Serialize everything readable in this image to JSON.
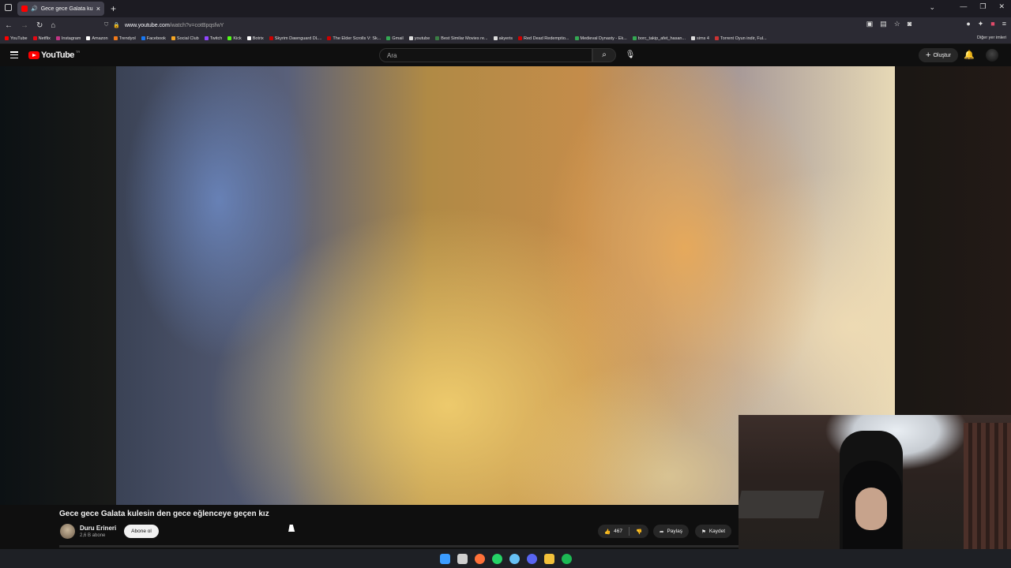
{
  "browser": {
    "tab_title": "Gece gece Galata kulesin d...",
    "url_host": "www.youtube.com",
    "url_path": "/watch?v=cotBpqsfwY",
    "bookmarks": [
      {
        "label": "YouTube",
        "color": "#ff0000"
      },
      {
        "label": "Netflix",
        "color": "#e50914"
      },
      {
        "label": "Instagram",
        "color": "#c13584"
      },
      {
        "label": "Amazon",
        "color": "#ffffff"
      },
      {
        "label": "Trendyol",
        "color": "#f27a1a"
      },
      {
        "label": "Facebook",
        "color": "#1877f2"
      },
      {
        "label": "Social Club",
        "color": "#f5a623"
      },
      {
        "label": "Twitch",
        "color": "#9146ff"
      },
      {
        "label": "Kick",
        "color": "#53fc18"
      },
      {
        "label": "Botrix",
        "color": "#ffffff"
      },
      {
        "label": "Skyrim Dawnguard DL...",
        "color": "#cc0000"
      },
      {
        "label": "The Elder Scrolls V: Sk...",
        "color": "#cc0000"
      },
      {
        "label": "Gmail",
        "color": "#34a853"
      },
      {
        "label": "youtube",
        "color": "#dddddd"
      },
      {
        "label": "Best Similar Movies re...",
        "color": "#3a7d44"
      },
      {
        "label": "akyeris",
        "color": "#dddddd"
      },
      {
        "label": "Red Dead Redemptio...",
        "color": "#cc0000"
      },
      {
        "label": "Medieval Dynasty - Ek...",
        "color": "#34a853"
      },
      {
        "label": "borc_takip_afet_hasan...",
        "color": "#34a853"
      },
      {
        "label": "sims 4",
        "color": "#dddddd"
      },
      {
        "label": "Torrent Oyun indir, Ful...",
        "color": "#cc3333"
      }
    ],
    "other_bookmarks": "Diğer yer imleri"
  },
  "youtube": {
    "logo_text": "YouTube",
    "logo_tr": "TR",
    "search_placeholder": "Ara",
    "create_label": "Oluştur"
  },
  "video": {
    "title": "Gece gece Galata kulesin den gece eğlenceye geçen kız",
    "channel_name": "Duru Erineri",
    "subscribers": "2,6 B abone",
    "subscribe_label": "Abone ol",
    "likes": "467",
    "share_label": "Paylaş",
    "save_label": "Kaydet"
  },
  "taskbar": {
    "apps": [
      {
        "name": "windows-start-icon",
        "color": "#3b9cff"
      },
      {
        "name": "search-icon",
        "color": "#cfcfcf"
      },
      {
        "name": "firefox-icon",
        "color": "#ff7139"
      },
      {
        "name": "whatsapp-icon",
        "color": "#25d366"
      },
      {
        "name": "steam-icon",
        "color": "#66c0f4"
      },
      {
        "name": "discord-icon",
        "color": "#5865f2"
      },
      {
        "name": "file-explorer-icon",
        "color": "#f3c13a"
      },
      {
        "name": "spotify-icon",
        "color": "#1db954"
      }
    ]
  },
  "colors": {
    "yt_red": "#ff0000",
    "background": "#0f0f0f",
    "pill": "#272727"
  }
}
